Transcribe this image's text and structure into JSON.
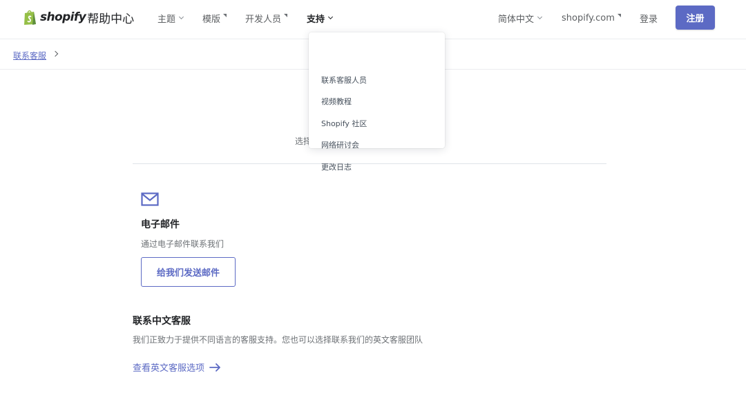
{
  "brand": {
    "wordmark": "shopify",
    "subtitle": "帮助中心",
    "accent": "#5c6ac4",
    "logo_icon": "shopify-bag-logo"
  },
  "nav": {
    "themes": "主题",
    "templates": "模版",
    "developers": "开发人员",
    "support": "支持",
    "language": "简体中文",
    "site": "shopify.com",
    "login": "登录",
    "signup": "注册"
  },
  "dropdown": {
    "items": [
      {
        "label": "联系客服人员"
      },
      {
        "label": "视频教程"
      },
      {
        "label": "Shopify 社区"
      },
      {
        "label": "网络研讨会"
      },
      {
        "label": "更改日志"
      }
    ]
  },
  "breadcrumb": {
    "link": "联系客服"
  },
  "intro": {
    "text": "选择"
  },
  "email": {
    "icon": "envelope-icon",
    "title": "电子邮件",
    "desc": "通过电子邮件联系我们",
    "button": "给我们发送邮件"
  },
  "chinese_support": {
    "title": "联系中文客服",
    "desc": "我们正致力于提供不同语言的客服支持。您也可以选择联系我们的英文客服团队",
    "link": "查看英文客服选项",
    "link_icon": "arrow-right-icon"
  }
}
